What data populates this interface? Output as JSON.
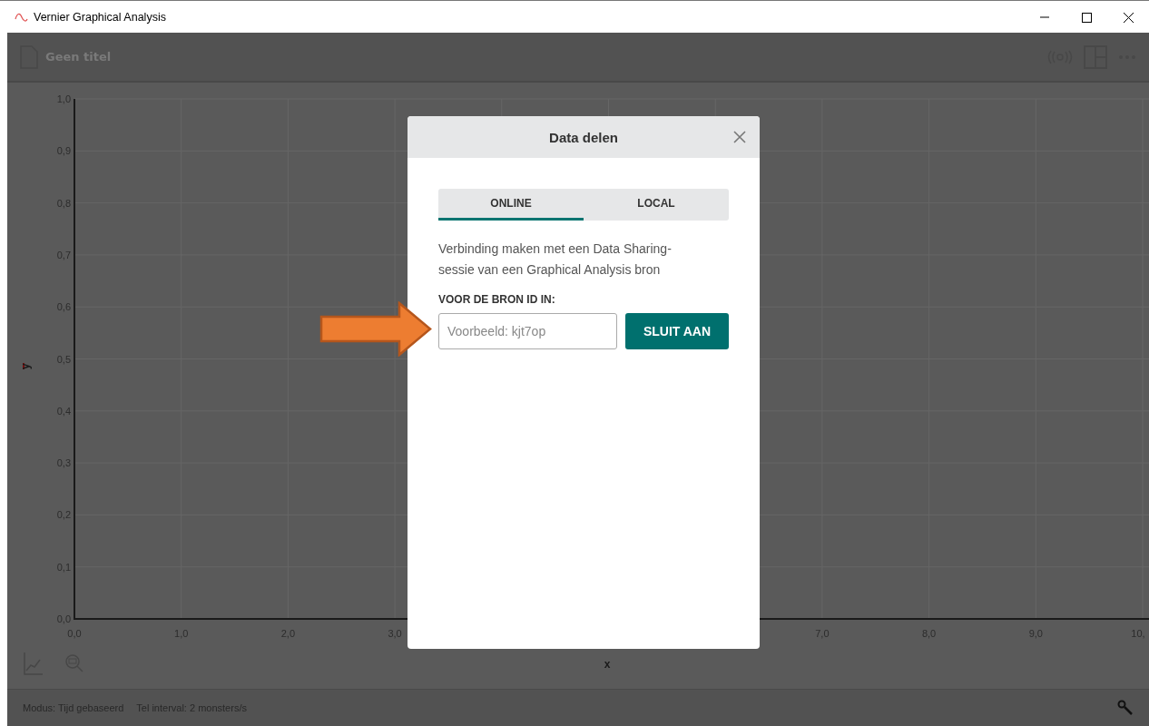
{
  "window": {
    "title": "Vernier Graphical Analysis"
  },
  "toolbar": {
    "document_title": "Geen titel"
  },
  "graph": {
    "chart_data": {
      "type": "scatter",
      "grid": true,
      "xlabel": "x",
      "ylabel": "y",
      "xlim": [
        0,
        10
      ],
      "ylim": [
        0,
        1
      ],
      "xticks": [
        {
          "value": 0,
          "label": "0,0"
        },
        {
          "value": 1,
          "label": "1,0"
        },
        {
          "value": 2,
          "label": "2,0"
        },
        {
          "value": 3,
          "label": "3,0"
        },
        {
          "value": 7,
          "label": "7,0"
        },
        {
          "value": 8,
          "label": "8,0"
        },
        {
          "value": 9,
          "label": "9,0"
        },
        {
          "value": 10,
          "label": "10,"
        }
      ],
      "yticks": [
        {
          "value": 0,
          "label": "0,0"
        },
        {
          "value": 0.1,
          "label": "0,1"
        },
        {
          "value": 0.2,
          "label": "0,2"
        },
        {
          "value": 0.3,
          "label": "0,3"
        },
        {
          "value": 0.4,
          "label": "0,4"
        },
        {
          "value": 0.5,
          "label": "0,5"
        },
        {
          "value": 0.6,
          "label": "0,6"
        },
        {
          "value": 0.7,
          "label": "0,7"
        },
        {
          "value": 0.8,
          "label": "0,8"
        },
        {
          "value": 0.9,
          "label": "0,9"
        },
        {
          "value": 1,
          "label": "1,0"
        }
      ]
    }
  },
  "status_bar": {
    "mode": "Modus: Tijd gebaseerd",
    "interval": "Tel interval: 2 monsters/s"
  },
  "dialog": {
    "title": "Data delen",
    "tabs": [
      {
        "label": "ONLINE",
        "selected": true
      },
      {
        "label": "LOCAL",
        "selected": false
      }
    ],
    "description": "Verbinding maken met een Data Sharing-sessie van een Graphical Analysis bron",
    "field_label": "VOOR DE BRON ID IN:",
    "field": {
      "placeholder": "Voorbeeld: kjt7op"
    },
    "button": "SLUIT AAN"
  }
}
